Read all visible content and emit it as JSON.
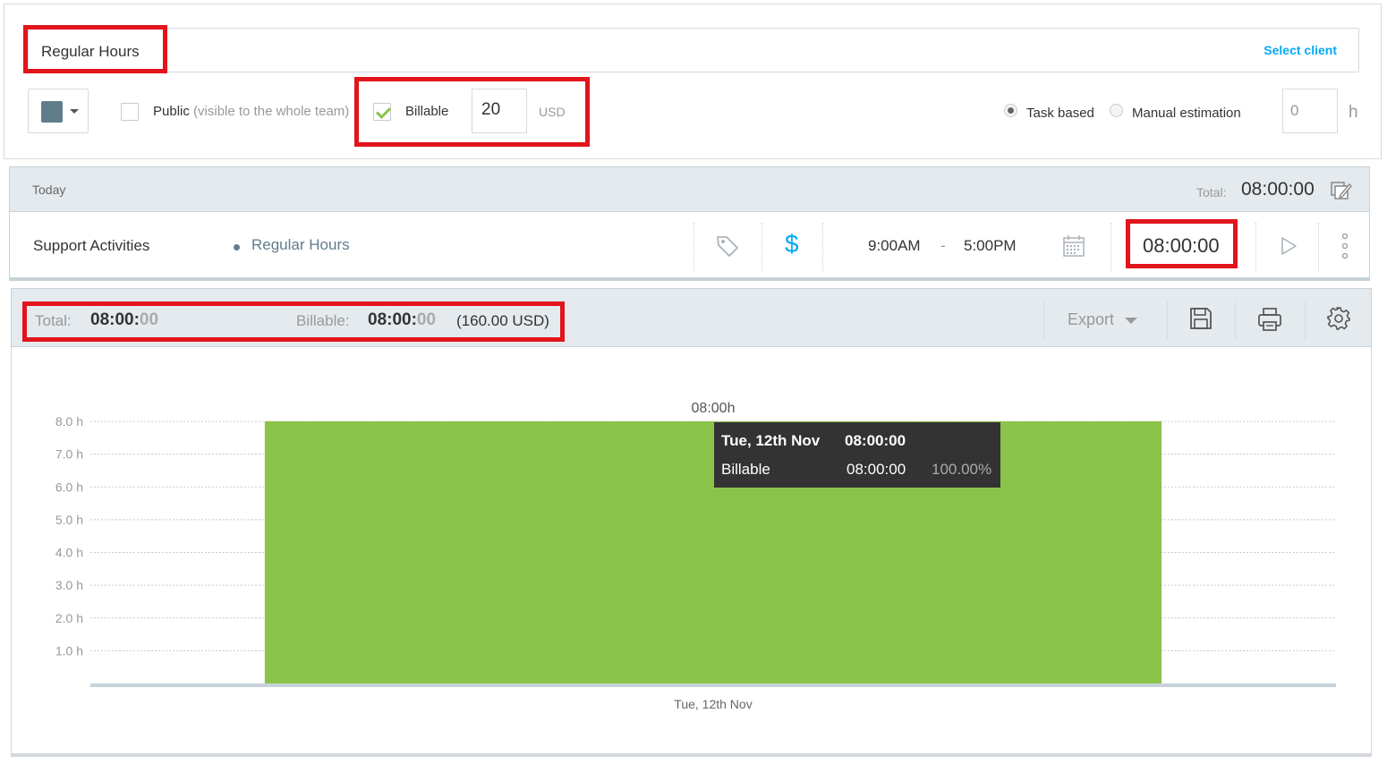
{
  "project_form": {
    "name": "Regular Hours",
    "select_client": "Select client",
    "color": "#607d8b",
    "public_label": "Public",
    "public_hint": "(visible to the whole team)",
    "public_checked": false,
    "billable_label": "Billable",
    "billable_checked": true,
    "rate": "20",
    "currency": "USD",
    "estimate_options": [
      "Task based",
      "Manual estimation"
    ],
    "estimate_selected": "Task based",
    "estimate_value": "0",
    "estimate_unit": "h"
  },
  "day_group": {
    "label": "Today",
    "total_label": "Total:",
    "total_value": "08:00:00"
  },
  "entry": {
    "description": "Support Activities",
    "project": "Regular Hours",
    "billable_symbol": "$",
    "start": "9:00AM",
    "separator": "-",
    "end": "5:00PM",
    "duration": "08:00:00"
  },
  "report": {
    "total_label": "Total:",
    "total_main": "08:00:",
    "total_seconds": "00",
    "billable_label": "Billable:",
    "billable_main": "08:00:",
    "billable_seconds": "00",
    "billable_amount": "(160.00 USD)",
    "export_label": "Export"
  },
  "chart_data": {
    "type": "bar",
    "categories": [
      "Tue, 12th Nov"
    ],
    "series": [
      {
        "name": "Billable",
        "values": [
          8.0
        ],
        "color": "#8bc34a"
      }
    ],
    "y_ticks": [
      "8.0 h",
      "7.0 h",
      "6.0 h",
      "5.0 h",
      "4.0 h",
      "3.0 h",
      "2.0 h",
      "1.0 h"
    ],
    "ylim": [
      0,
      8
    ],
    "bar_label": "08:00h",
    "grid": true
  },
  "tooltip": {
    "date": "Tue, 12th Nov",
    "date_value": "08:00:00",
    "series": "Billable",
    "series_value": "08:00:00",
    "percent": "100.00%"
  },
  "colors": {
    "accent": "#03a9f4",
    "bar": "#8bc34a",
    "highlight": "#e2141c"
  }
}
